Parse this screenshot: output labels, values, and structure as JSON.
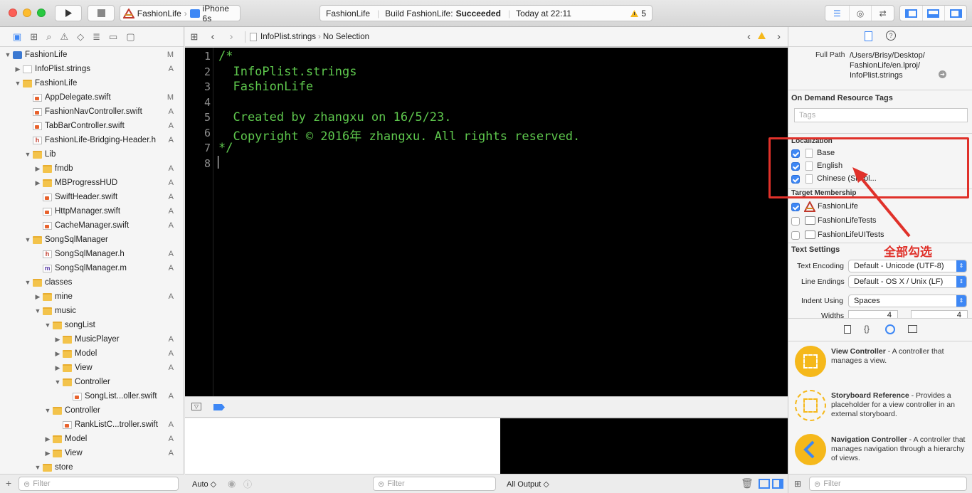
{
  "toolbar": {
    "scheme_target": "FashionLife",
    "device": "iPhone 6s",
    "activity_project": "FashionLife",
    "activity_status_prefix": "Build FashionLife:",
    "activity_status": "Succeeded",
    "activity_time": "Today at 22:11",
    "warning_count": "5"
  },
  "navigator": {
    "items": [
      {
        "label": "FashionLife",
        "badge": "M",
        "depth": 0,
        "type": "project",
        "open": true
      },
      {
        "label": "InfoPlist.strings",
        "badge": "A",
        "depth": 1,
        "type": "plain",
        "open": false,
        "expandable": true
      },
      {
        "label": "FashionLife",
        "badge": "",
        "depth": 1,
        "type": "folder",
        "open": true
      },
      {
        "label": "AppDelegate.swift",
        "badge": "M",
        "depth": 2,
        "type": "swift"
      },
      {
        "label": "FashionNavController.swift",
        "badge": "A",
        "depth": 2,
        "type": "swift"
      },
      {
        "label": "TabBarController.swift",
        "badge": "A",
        "depth": 2,
        "type": "swift"
      },
      {
        "label": "FashionLife-Bridging-Header.h",
        "badge": "A",
        "depth": 2,
        "type": "h"
      },
      {
        "label": "Lib",
        "badge": "",
        "depth": 2,
        "type": "folder",
        "open": true
      },
      {
        "label": "fmdb",
        "badge": "A",
        "depth": 3,
        "type": "folder",
        "open": false
      },
      {
        "label": "MBProgressHUD",
        "badge": "A",
        "depth": 3,
        "type": "folder",
        "open": false
      },
      {
        "label": "SwiftHeader.swift",
        "badge": "A",
        "depth": 3,
        "type": "swift"
      },
      {
        "label": "HttpManager.swift",
        "badge": "A",
        "depth": 3,
        "type": "swift"
      },
      {
        "label": "CacheManager.swift",
        "badge": "A",
        "depth": 3,
        "type": "swift"
      },
      {
        "label": "SongSqlManager",
        "badge": "",
        "depth": 2,
        "type": "folder",
        "open": true
      },
      {
        "label": "SongSqlManager.h",
        "badge": "A",
        "depth": 3,
        "type": "h"
      },
      {
        "label": "SongSqlManager.m",
        "badge": "A",
        "depth": 3,
        "type": "m"
      },
      {
        "label": "classes",
        "badge": "",
        "depth": 2,
        "type": "folder",
        "open": true
      },
      {
        "label": "mine",
        "badge": "A",
        "depth": 3,
        "type": "folder",
        "open": false
      },
      {
        "label": "music",
        "badge": "",
        "depth": 3,
        "type": "folder",
        "open": true
      },
      {
        "label": "songList",
        "badge": "",
        "depth": 4,
        "type": "folder",
        "open": true
      },
      {
        "label": "MusicPlayer",
        "badge": "A",
        "depth": 5,
        "type": "folder",
        "open": false
      },
      {
        "label": "Model",
        "badge": "A",
        "depth": 5,
        "type": "folder",
        "open": false
      },
      {
        "label": "View",
        "badge": "A",
        "depth": 5,
        "type": "folder",
        "open": false
      },
      {
        "label": "Controller",
        "badge": "",
        "depth": 5,
        "type": "folder",
        "open": true
      },
      {
        "label": "SongList...oller.swift",
        "badge": "A",
        "depth": 6,
        "type": "swift"
      },
      {
        "label": "Controller",
        "badge": "",
        "depth": 4,
        "type": "folder",
        "open": true
      },
      {
        "label": "RankListC...troller.swift",
        "badge": "A",
        "depth": 5,
        "type": "swift"
      },
      {
        "label": "Model",
        "badge": "A",
        "depth": 4,
        "type": "folder",
        "open": false
      },
      {
        "label": "View",
        "badge": "A",
        "depth": 4,
        "type": "folder",
        "open": false
      },
      {
        "label": "store",
        "badge": "",
        "depth": 3,
        "type": "folder",
        "open": true
      }
    ],
    "filter_placeholder": "Filter"
  },
  "jumpbar": {
    "file": "InfoPlist.strings",
    "selection": "No Selection"
  },
  "editor": {
    "lines": [
      "/*",
      "  InfoPlist.strings",
      "  FashionLife",
      "",
      "  Created by zhangxu on 16/5/23.",
      "  Copyright © 2016年 zhangxu. All rights reserved.",
      "*/",
      ""
    ],
    "line_numbers": [
      "1",
      "2",
      "3",
      "4",
      "5",
      "6",
      "7",
      "8"
    ]
  },
  "debug": {
    "auto_label": "Auto ◇",
    "filter_placeholder": "Filter",
    "output_label": "All Output ◇"
  },
  "inspector": {
    "full_path_label": "Full Path",
    "full_path": [
      "/Users/Brisy/Desktop/",
      "FashionLife/en.lproj/",
      "InfoPlist.strings"
    ],
    "odr_title": "On Demand Resource Tags",
    "tags_placeholder": "Tags",
    "localization_title": "Localization",
    "localizations": [
      {
        "label": "Base",
        "checked": true
      },
      {
        "label": "English",
        "checked": true
      },
      {
        "label": "Chinese (Simpl...",
        "checked": true
      }
    ],
    "target_title": "Target Membership",
    "targets": [
      {
        "label": "FashionLife",
        "checked": true
      },
      {
        "label": "FashionLifeTests",
        "checked": false
      },
      {
        "label": "FashionLifeUITests",
        "checked": false
      }
    ],
    "text_settings_title": "Text Settings",
    "text_encoding_label": "Text Encoding",
    "text_encoding": "Default - Unicode (UTF-8)",
    "line_endings_label": "Line Endings",
    "line_endings": "Default - OS X / Unix (LF)",
    "indent_label": "Indent Using",
    "indent": "Spaces",
    "widths_label": "Widths",
    "width_tab": "4",
    "width_indent": "4"
  },
  "library": {
    "items": [
      {
        "name": "View Controller",
        "desc": " - A controller that manages a view."
      },
      {
        "name": "Storyboard Reference",
        "desc": " - Provides a placeholder for a view controller in an external storyboard."
      },
      {
        "name": "Navigation Controller",
        "desc": " - A controller that manages navigation through a hierarchy of views."
      }
    ],
    "filter_placeholder": "Filter"
  },
  "annotation": {
    "text": "全部勾选",
    "color": "#e0312a"
  }
}
